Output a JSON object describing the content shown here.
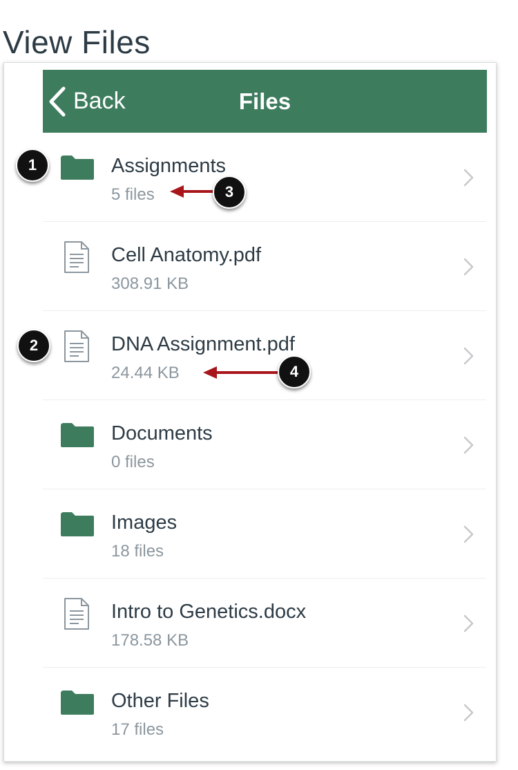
{
  "page_title": "View Files",
  "nav": {
    "back_label": "Back",
    "title": "Files"
  },
  "items": [
    {
      "type": "folder",
      "name": "Assignments",
      "meta": "5 files"
    },
    {
      "type": "file",
      "name": "Cell Anatomy.pdf",
      "meta": "308.91 KB"
    },
    {
      "type": "file",
      "name": "DNA Assignment.pdf",
      "meta": "24.44 KB"
    },
    {
      "type": "folder",
      "name": "Documents",
      "meta": "0 files"
    },
    {
      "type": "folder",
      "name": "Images",
      "meta": "18 files"
    },
    {
      "type": "file",
      "name": "Intro to Genetics.docx",
      "meta": "178.58 KB"
    },
    {
      "type": "folder",
      "name": "Other Files",
      "meta": "17 files"
    }
  ],
  "callouts": [
    "1",
    "2",
    "3",
    "4"
  ],
  "colors": {
    "nav_background": "#3e7c5e",
    "folder_icon": "#3e7c5e",
    "callout_arrow": "#a8161b",
    "callout_badge": "#111111"
  },
  "icons": {
    "back": "chevron-left-icon",
    "folder": "folder-icon",
    "file": "document-icon",
    "disclosure": "chevron-right-icon"
  }
}
